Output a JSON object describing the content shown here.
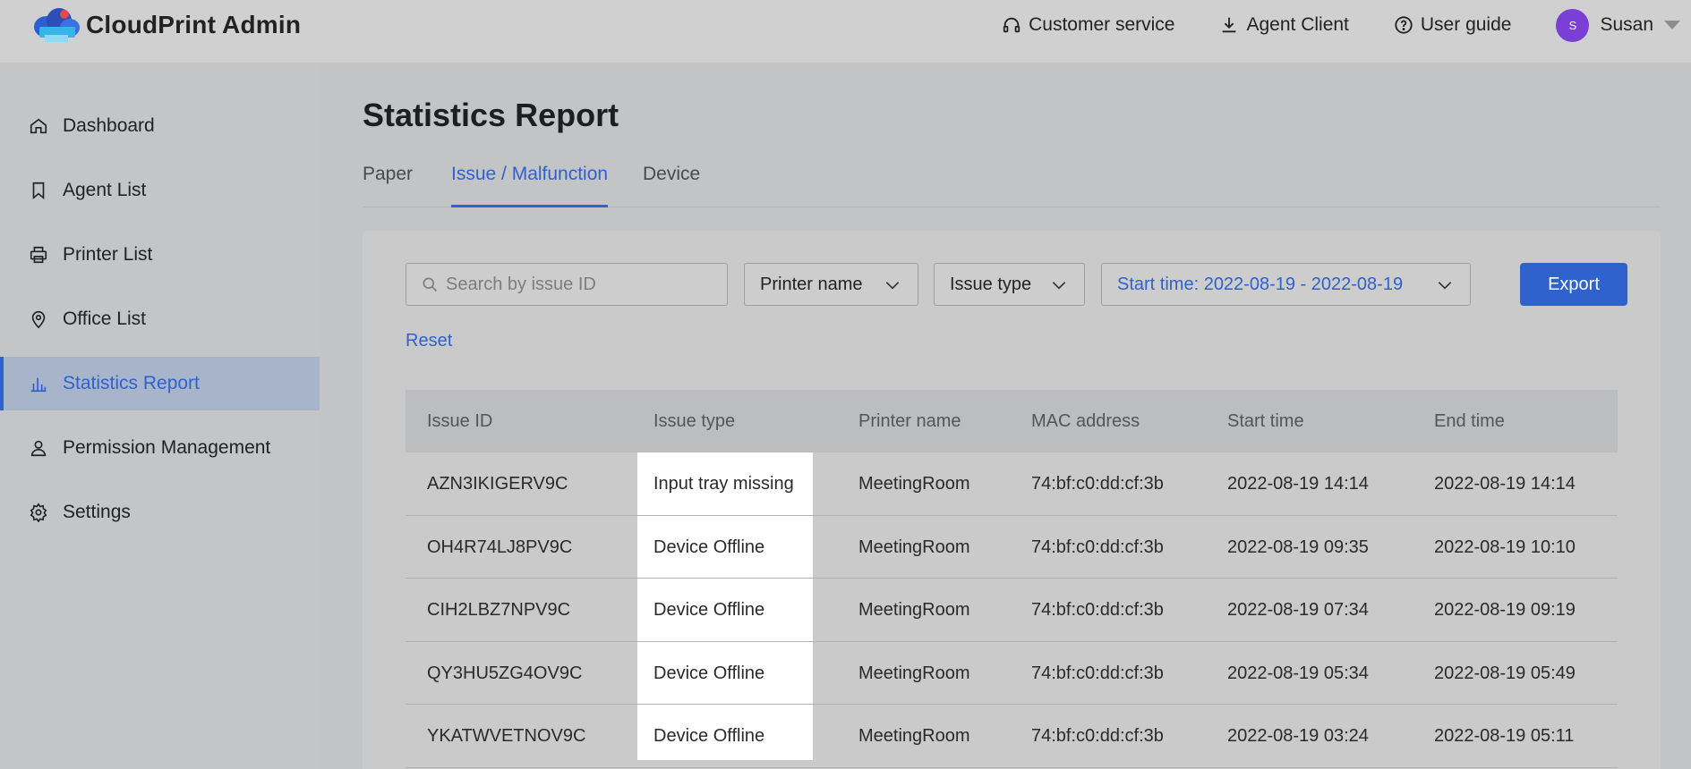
{
  "header": {
    "brand": "CloudPrint Admin",
    "actions": [
      {
        "label": "Customer service",
        "icon": "headset-icon"
      },
      {
        "label": "Agent Client",
        "icon": "download-icon"
      },
      {
        "label": "User guide",
        "icon": "help-circle-icon"
      }
    ],
    "user": {
      "initial": "S",
      "name": "Susan",
      "avatar_color": "#7b3fd6"
    }
  },
  "sidebar": {
    "items": [
      {
        "label": "Dashboard",
        "icon": "home-icon"
      },
      {
        "label": "Agent List",
        "icon": "bookmark-icon"
      },
      {
        "label": "Printer List",
        "icon": "printer-icon"
      },
      {
        "label": "Office List",
        "icon": "location-pin-icon"
      },
      {
        "label": "Statistics Report",
        "icon": "bar-chart-icon",
        "active": true
      },
      {
        "label": "Permission Management",
        "icon": "user-icon"
      },
      {
        "label": "Settings",
        "icon": "gear-icon"
      }
    ]
  },
  "main": {
    "title": "Statistics Report",
    "tabs": [
      {
        "label": "Paper"
      },
      {
        "label": "Issue / Malfunction",
        "active": true
      },
      {
        "label": "Device"
      }
    ],
    "filters": {
      "search_placeholder": "Search by issue ID",
      "printer_name": "Printer name",
      "issue_type": "Issue type",
      "start_time": "Start time: 2022-08-19 - 2022-08-19",
      "export": "Export",
      "reset": "Reset"
    },
    "table": {
      "columns": [
        "Issue ID",
        "Issue type",
        "Printer name",
        "MAC address",
        "Start time",
        "End time"
      ],
      "rows": [
        [
          "AZN3IKIGERV9C",
          "Input tray missing",
          "MeetingRoom",
          "74:bf:c0:dd:cf:3b",
          "2022-08-19 14:14",
          "2022-08-19 14:14"
        ],
        [
          "OH4R74LJ8PV9C",
          "Device Offline",
          "MeetingRoom",
          "74:bf:c0:dd:cf:3b",
          "2022-08-19 09:35",
          "2022-08-19 10:10"
        ],
        [
          "CIH2LBZ7NPV9C",
          "Device Offline",
          "MeetingRoom",
          "74:bf:c0:dd:cf:3b",
          "2022-08-19 07:34",
          "2022-08-19 09:19"
        ],
        [
          "QY3HU5ZG4OV9C",
          "Device Offline",
          "MeetingRoom",
          "74:bf:c0:dd:cf:3b",
          "2022-08-19 05:34",
          "2022-08-19 05:49"
        ],
        [
          "YKATWVETNOV9C",
          "Device Offline",
          "MeetingRoom",
          "74:bf:c0:dd:cf:3b",
          "2022-08-19 03:24",
          "2022-08-19 05:11"
        ]
      ]
    }
  },
  "colors": {
    "accent": "#2f62cc"
  }
}
